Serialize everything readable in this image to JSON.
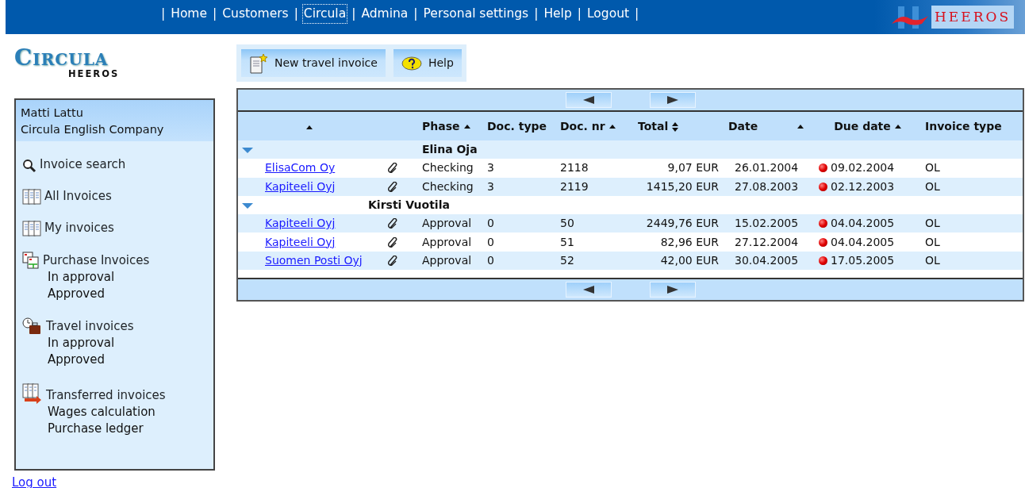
{
  "top_nav": {
    "separators": [
      "|",
      "|",
      "|",
      "|",
      "|",
      "|",
      "|",
      "|"
    ],
    "items": [
      {
        "label": "Home",
        "focused": false
      },
      {
        "label": "Customers",
        "focused": false
      },
      {
        "label": "Circula",
        "focused": true
      },
      {
        "label": "Admina",
        "focused": false
      },
      {
        "label": "Personal settings",
        "focused": false
      },
      {
        "label": "Help",
        "focused": false
      },
      {
        "label": "Logout",
        "focused": false
      }
    ]
  },
  "corner_logo": "HEEROS",
  "app_logo": {
    "title": "CIRCULA",
    "subtitle": "HEEROS"
  },
  "user": {
    "name": "Matti Lattu",
    "company": "Circula English Company"
  },
  "sidebar": [
    {
      "label": "Invoice search",
      "kind": "search"
    },
    {
      "label": "All Invoices",
      "kind": "docs"
    },
    {
      "label": "My invoices",
      "kind": "docs"
    },
    {
      "label": "Purchase Invoices",
      "kind": "purchase",
      "children": [
        {
          "label": "In approval"
        },
        {
          "label": "Approved"
        }
      ]
    },
    {
      "label": "Travel invoices",
      "kind": "travel",
      "children": [
        {
          "label": "In approval"
        },
        {
          "label": "Approved"
        }
      ]
    },
    {
      "label": "Transferred invoices",
      "kind": "transfer",
      "children": [
        {
          "label": "Wages calculation"
        },
        {
          "label": "Purchase ledger"
        }
      ]
    }
  ],
  "logout_link": "Log out",
  "toolbar": [
    {
      "label": "New travel invoice",
      "kind": "new"
    },
    {
      "label": "Help",
      "kind": "help"
    }
  ],
  "table": {
    "columns": [
      {
        "sort_up": true,
        "sort_down": false
      },
      {
        "label": "Phase",
        "sort_up": true,
        "sort_down": false
      },
      {
        "label": "Doc. type",
        "sort_up": false,
        "sort_down": false
      },
      {
        "label": "Doc. nr",
        "sort_up": true,
        "sort_down": false
      },
      {
        "label": "Total",
        "sort_up": true,
        "sort_down": true
      },
      {
        "label": "Date",
        "sort_up": true,
        "sort_down": false
      },
      {
        "label": "Due date",
        "sort_up": true,
        "sort_down": false
      },
      {
        "label": "Invoice type",
        "sort_up": false,
        "sort_down": false
      }
    ],
    "groups": [
      {
        "name": "Elina Oja",
        "expanded": true,
        "rows": [
          {
            "company": "ElisaCom Oy",
            "attachment": true,
            "phase": "Checking",
            "doc_type": "3",
            "doc_nr": "2118",
            "total": "9,07",
            "currency": "EUR",
            "date": "26.01.2004",
            "overdue": true,
            "due_date": "09.02.2004",
            "invoice_type": "OL"
          },
          {
            "company": "Kapiteeli Oyj",
            "attachment": true,
            "phase": "Checking",
            "doc_type": "3",
            "doc_nr": "2119",
            "total": "1415,20",
            "currency": "EUR",
            "date": "27.08.2003",
            "overdue": true,
            "due_date": "02.12.2003",
            "invoice_type": "OL"
          }
        ]
      },
      {
        "name": "Kirsti Vuotila",
        "expanded": true,
        "rows": [
          {
            "company": "Kapiteeli Oyj",
            "attachment": true,
            "phase": "Approval",
            "doc_type": "0",
            "doc_nr": "50",
            "total": "2449,76",
            "currency": "EUR",
            "date": "15.02.2005",
            "overdue": true,
            "due_date": "04.04.2005",
            "invoice_type": "OL"
          },
          {
            "company": "Kapiteeli Oyj",
            "attachment": true,
            "phase": "Approval",
            "doc_type": "0",
            "doc_nr": "51",
            "total": "82,96",
            "currency": "EUR",
            "date": "27.12.2004",
            "overdue": true,
            "due_date": "04.04.2005",
            "invoice_type": "OL"
          },
          {
            "company": "Suomen Posti Oyj",
            "attachment": true,
            "phase": "Approval",
            "doc_type": "0",
            "doc_nr": "52",
            "total": "42,00",
            "currency": "EUR",
            "date": "30.04.2005",
            "overdue": true,
            "due_date": "17.05.2005",
            "invoice_type": "OL"
          }
        ]
      }
    ]
  }
}
